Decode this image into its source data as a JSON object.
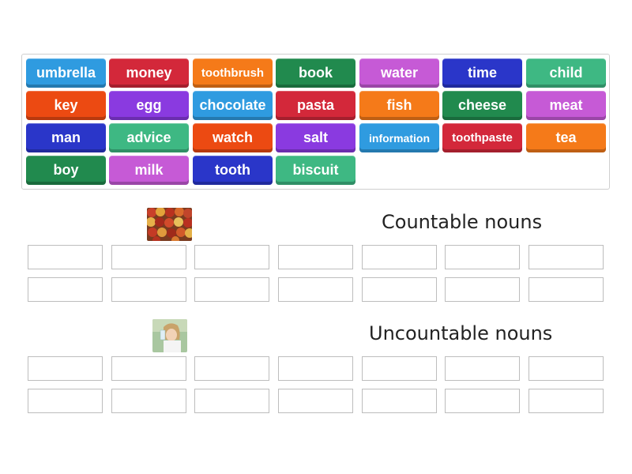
{
  "tiles": [
    {
      "label": "umbrella",
      "color": "#2f9be0"
    },
    {
      "label": "money",
      "color": "#d3283a"
    },
    {
      "label": "toothbrush",
      "color": "#f57a19"
    },
    {
      "label": "book",
      "color": "#218a4e"
    },
    {
      "label": "water",
      "color": "#c65ad6"
    },
    {
      "label": "time",
      "color": "#2a36c9"
    },
    {
      "label": "child",
      "color": "#3eb883"
    },
    {
      "label": "key",
      "color": "#ec4a12"
    },
    {
      "label": "egg",
      "color": "#8a3ae0"
    },
    {
      "label": "chocolate",
      "color": "#2f9be0"
    },
    {
      "label": "pasta",
      "color": "#d3283a"
    },
    {
      "label": "fish",
      "color": "#f57a19"
    },
    {
      "label": "cheese",
      "color": "#218a4e"
    },
    {
      "label": "meat",
      "color": "#c65ad6"
    },
    {
      "label": "man",
      "color": "#2a36c9"
    },
    {
      "label": "advice",
      "color": "#3eb883"
    },
    {
      "label": "watch",
      "color": "#ec4a12"
    },
    {
      "label": "salt",
      "color": "#8a3ae0"
    },
    {
      "label": "information",
      "color": "#2f9be0"
    },
    {
      "label": "toothpaste",
      "color": "#d3283a"
    },
    {
      "label": "tea",
      "color": "#f57a19"
    },
    {
      "label": "boy",
      "color": "#218a4e"
    },
    {
      "label": "milk",
      "color": "#c65ad6"
    },
    {
      "label": "tooth",
      "color": "#2a36c9"
    },
    {
      "label": "biscuit",
      "color": "#3eb883"
    }
  ],
  "groups": [
    {
      "title": "Countable nouns",
      "image": "apples-image"
    },
    {
      "title": "Uncountable nouns",
      "image": "girl-drinking-image"
    }
  ]
}
